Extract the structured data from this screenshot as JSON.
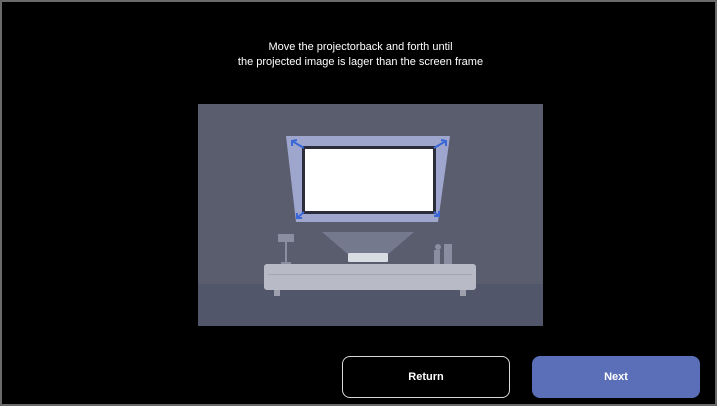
{
  "instruction": {
    "line1": "Move the projectorback and forth until",
    "line2": "the projected image is lager than the screen frame"
  },
  "illustration": {
    "description_icon": "projector-screen-illustration-icon"
  },
  "buttons": {
    "return_label": "Return",
    "next_label": "Next"
  },
  "colors": {
    "background": "#000000",
    "accent": "#5b6fb8",
    "illustration_bg": "#595d6e"
  }
}
